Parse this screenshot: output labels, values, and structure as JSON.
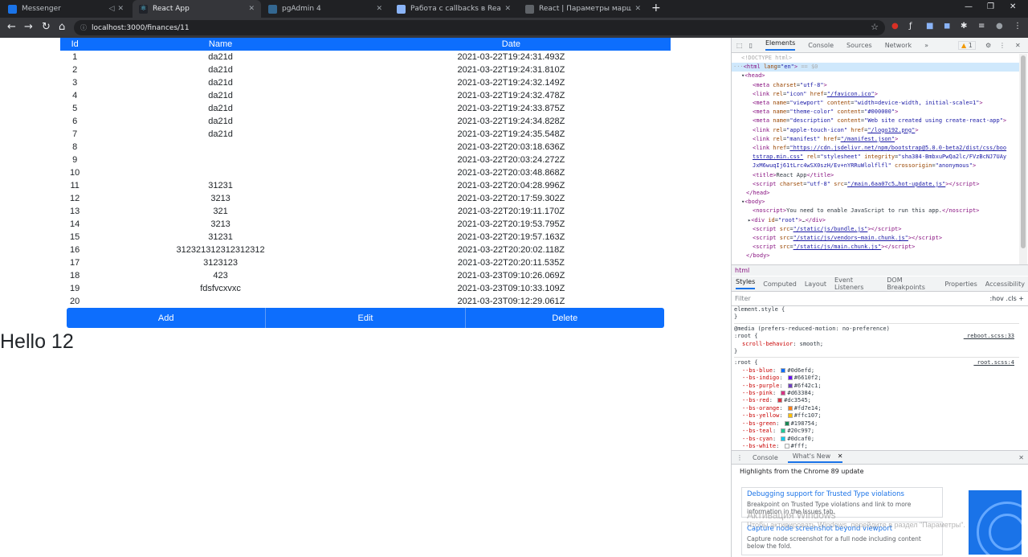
{
  "browser": {
    "tabs": [
      {
        "title": "Messenger",
        "color": "#1a73e8"
      },
      {
        "title": "React App",
        "color": "#61dafb"
      },
      {
        "title": "pgAdmin 4",
        "color": "#336791"
      },
      {
        "title": "Работа с callbacks в React / Блог",
        "color": "#8ab4f8"
      },
      {
        "title": "React | Параметры маршрутов",
        "color": "#5f6368"
      }
    ],
    "address": "localhost:3000/finances/11"
  },
  "table": {
    "headers": [
      "Id",
      "Name",
      "Date"
    ],
    "rows": [
      {
        "id": "1",
        "name": "da21d",
        "date": "2021-03-22T19:24:31.493Z"
      },
      {
        "id": "2",
        "name": "da21d",
        "date": "2021-03-22T19:24:31.810Z"
      },
      {
        "id": "3",
        "name": "da21d",
        "date": "2021-03-22T19:24:32.149Z"
      },
      {
        "id": "4",
        "name": "da21d",
        "date": "2021-03-22T19:24:32.478Z"
      },
      {
        "id": "5",
        "name": "da21d",
        "date": "2021-03-22T19:24:33.875Z"
      },
      {
        "id": "6",
        "name": "da21d",
        "date": "2021-03-22T19:24:34.828Z"
      },
      {
        "id": "7",
        "name": "da21d",
        "date": "2021-03-22T19:24:35.548Z"
      },
      {
        "id": "8",
        "name": "",
        "date": "2021-03-22T20:03:18.636Z"
      },
      {
        "id": "9",
        "name": "",
        "date": "2021-03-22T20:03:24.272Z"
      },
      {
        "id": "10",
        "name": "",
        "date": "2021-03-22T20:03:48.868Z"
      },
      {
        "id": "11",
        "name": "31231",
        "date": "2021-03-22T20:04:28.996Z"
      },
      {
        "id": "12",
        "name": "3213",
        "date": "2021-03-22T20:17:59.302Z"
      },
      {
        "id": "13",
        "name": "321",
        "date": "2021-03-22T20:19:11.170Z"
      },
      {
        "id": "14",
        "name": "3213",
        "date": "2021-03-22T20:19:53.795Z"
      },
      {
        "id": "15",
        "name": "31231",
        "date": "2021-03-22T20:19:57.163Z"
      },
      {
        "id": "16",
        "name": "312321312312312312",
        "date": "2021-03-22T20:20:02.118Z"
      },
      {
        "id": "17",
        "name": "3123123",
        "date": "2021-03-22T20:20:11.535Z"
      },
      {
        "id": "18",
        "name": "423",
        "date": "2021-03-23T09:10:26.069Z"
      },
      {
        "id": "19",
        "name": "fdsfvcxvxc",
        "date": "2021-03-23T09:10:33.109Z"
      },
      {
        "id": "20",
        "name": "",
        "date": "2021-03-23T09:12:29.061Z"
      }
    ]
  },
  "actions": {
    "add": "Add",
    "edit": "Edit",
    "delete": "Delete"
  },
  "heading": "Hello 12",
  "devtools": {
    "tabs": [
      "Elements",
      "Console",
      "Sources",
      "Network"
    ],
    "warning_count": "1",
    "crumb": "html",
    "subtabs": [
      "Styles",
      "Computed",
      "Layout",
      "Event Listeners",
      "DOM Breakpoints",
      "Properties",
      "Accessibility"
    ],
    "filter_placeholder": "Filter",
    "filter_tools": ":hov  .cls  +",
    "drawer_tabs": [
      "Console",
      "What's New"
    ],
    "whats_new_title": "Highlights from the Chrome 89 update",
    "cards": [
      {
        "title": "Debugging support for Trusted Type violations",
        "desc": "Breakpoint on Trusted Type violations and link to more information in the Issues tab."
      },
      {
        "title": "Capture node screenshot beyond viewport",
        "desc": "Capture node screenshot for a full node including content below the fold."
      }
    ],
    "css_vars": [
      {
        "name": "--bs-blue",
        "value": "#0d6efd"
      },
      {
        "name": "--bs-indigo",
        "value": "#6610f2"
      },
      {
        "name": "--bs-purple",
        "value": "#6f42c1"
      },
      {
        "name": "--bs-pink",
        "value": "#d63384"
      },
      {
        "name": "--bs-red",
        "value": "#dc3545"
      },
      {
        "name": "--bs-orange",
        "value": "#fd7e14"
      },
      {
        "name": "--bs-yellow",
        "value": "#ffc107"
      },
      {
        "name": "--bs-green",
        "value": "#198754"
      },
      {
        "name": "--bs-teal",
        "value": "#20c997"
      },
      {
        "name": "--bs-cyan",
        "value": "#0dcaf0"
      },
      {
        "name": "--bs-white",
        "value": "#fff"
      }
    ]
  },
  "watermark": {
    "line1": "Активация Windows",
    "line2": "Чтобы активировать Windows, перейдите в раздел \"Параметры\"."
  }
}
